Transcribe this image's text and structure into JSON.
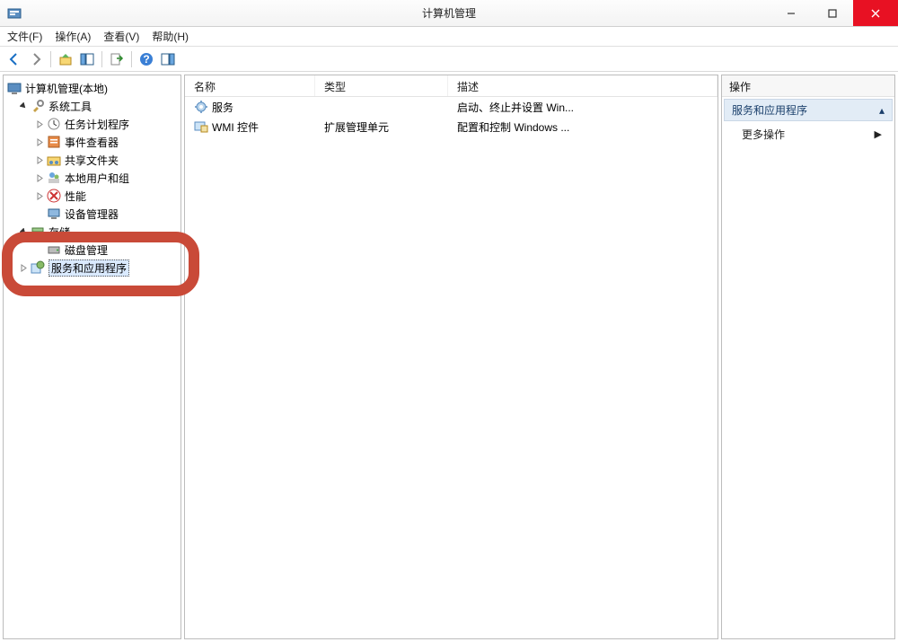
{
  "window": {
    "title": "计算机管理"
  },
  "menubar": {
    "file": "文件(F)",
    "action": "操作(A)",
    "view": "查看(V)",
    "help": "帮助(H)"
  },
  "tree": {
    "root": "计算机管理(本地)",
    "systools": "系统工具",
    "systools_children": {
      "task": "任务计划程序",
      "event": "事件查看器",
      "shared": "共享文件夹",
      "users": "本地用户和组",
      "perf": "性能",
      "devmgr": "设备管理器"
    },
    "storage": "存储",
    "storage_children": {
      "disk": "磁盘管理"
    },
    "services_apps": "服务和应用程序"
  },
  "list": {
    "headers": {
      "name": "名称",
      "type": "类型",
      "desc": "描述"
    },
    "rows": [
      {
        "name": "服务",
        "type": "",
        "desc": "启动、终止并设置 Win..."
      },
      {
        "name": "WMI 控件",
        "type": "扩展管理单元",
        "desc": "配置和控制 Windows ..."
      }
    ]
  },
  "actions": {
    "header": "操作",
    "group_title": "服务和应用程序",
    "more": "更多操作"
  }
}
